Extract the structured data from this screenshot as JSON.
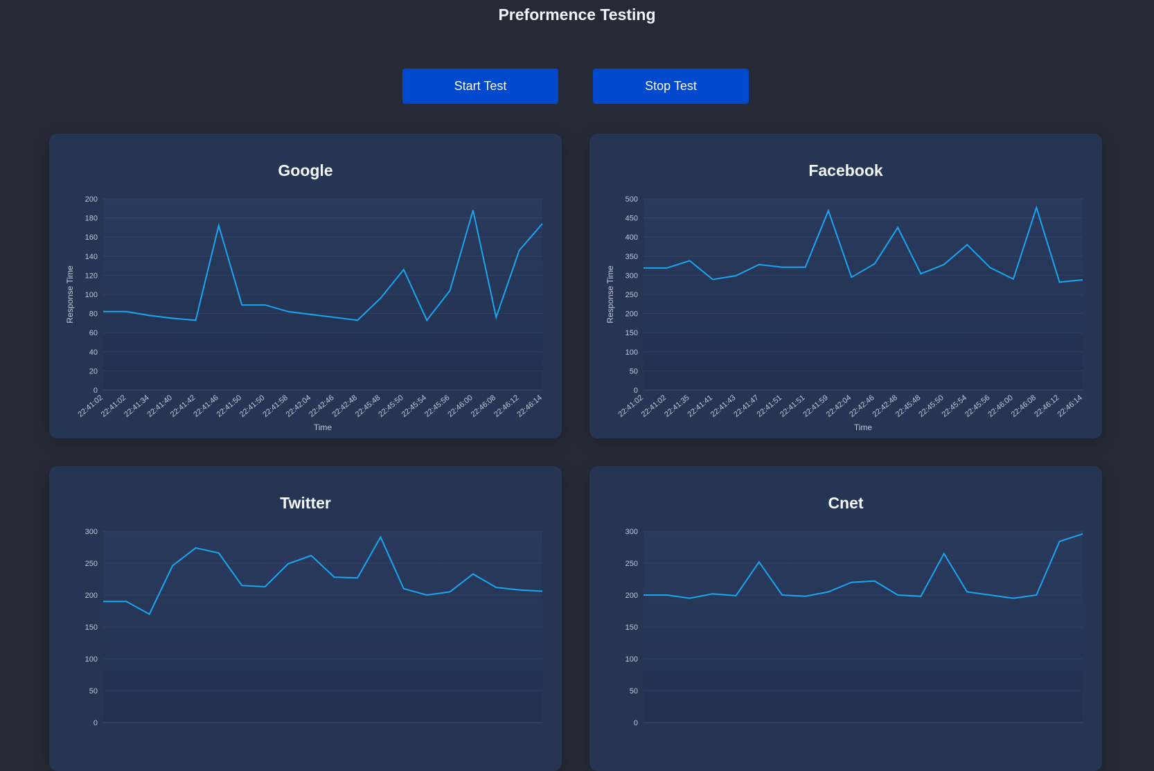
{
  "page_title": "Preformence Testing",
  "controls": {
    "start_label": "Start Test",
    "stop_label": "Stop Test"
  },
  "colors": {
    "background": "#252a36",
    "card": "#263554",
    "button": "#0048cc",
    "line": "#1aa6f0",
    "text": "#ffffff",
    "tick_text": "#c3c9d6"
  },
  "chart_data": [
    {
      "type": "line",
      "title": "Google",
      "xlabel": "Time",
      "ylabel": "Response Time",
      "ylim": [
        0,
        200
      ],
      "yticks": [
        0,
        20,
        40,
        60,
        80,
        100,
        120,
        140,
        160,
        180,
        200
      ],
      "grid": true,
      "categories": [
        "22:41:02",
        "22:41:02",
        "22:41:34",
        "22:41:40",
        "22:41:42",
        "22:41:46",
        "22:41:50",
        "22:41:50",
        "22:41:58",
        "22:42:04",
        "22:42:46",
        "22:42:48",
        "22:45:48",
        "22:45:50",
        "22:45:54",
        "22:45:56",
        "22:46:00",
        "22:46:08",
        "22:46:12",
        "22:46:14"
      ],
      "values": [
        82,
        82,
        78,
        75,
        73,
        172,
        89,
        89,
        82,
        79,
        76,
        73,
        96,
        126,
        73,
        104,
        188,
        76,
        146,
        174
      ]
    },
    {
      "type": "line",
      "title": "Facebook",
      "xlabel": "Time",
      "ylabel": "Response Time",
      "ylim": [
        0,
        500
      ],
      "yticks": [
        0,
        50,
        100,
        150,
        200,
        250,
        300,
        350,
        400,
        450,
        500
      ],
      "grid": true,
      "categories": [
        "22:41:02",
        "22:41:02",
        "22:41:35",
        "22:41:41",
        "22:41:43",
        "22:41:47",
        "22:41:51",
        "22:41:51",
        "22:41:59",
        "22:42:04",
        "22:42:46",
        "22:42:48",
        "22:45:48",
        "22:45:50",
        "22:45:54",
        "22:45:56",
        "22:46:00",
        "22:46:08",
        "22:46:12",
        "22:46:14"
      ],
      "values": [
        319,
        319,
        338,
        289,
        299,
        328,
        321,
        321,
        469,
        295,
        330,
        425,
        304,
        328,
        380,
        320,
        290,
        477,
        282,
        288
      ]
    },
    {
      "type": "line",
      "title": "Twitter",
      "ylim": [
        0,
        300
      ],
      "yticks": [
        0,
        50,
        100,
        150,
        200,
        250,
        300
      ],
      "grid": true,
      "values": [
        190,
        190,
        170,
        246,
        274,
        266,
        215,
        213,
        249,
        262,
        228,
        227,
        291,
        210,
        200,
        205,
        233,
        212,
        208,
        206
      ]
    },
    {
      "type": "line",
      "title": "Cnet",
      "ylim": [
        0,
        300
      ],
      "yticks": [
        0,
        50,
        100,
        150,
        200,
        250,
        300
      ],
      "grid": true,
      "values": [
        200,
        200,
        195,
        202,
        199,
        252,
        200,
        198,
        205,
        220,
        222,
        200,
        198,
        265,
        205,
        200,
        195,
        200,
        284,
        296
      ]
    }
  ]
}
